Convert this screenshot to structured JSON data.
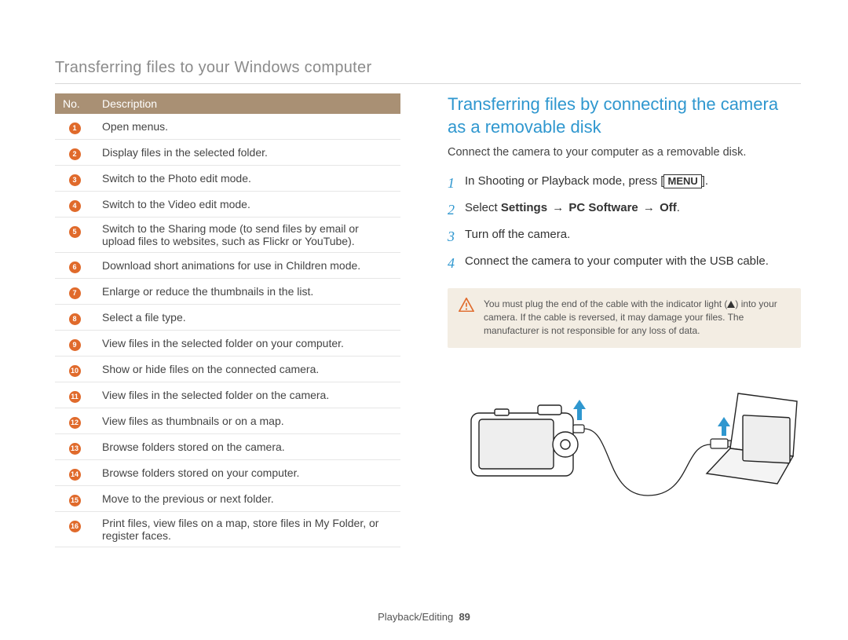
{
  "page_title": "Transferring files to your Windows computer",
  "table": {
    "headers": {
      "no": "No.",
      "desc": "Description"
    },
    "rows": [
      {
        "n": "1",
        "d": "Open menus."
      },
      {
        "n": "2",
        "d": "Display files in the selected folder."
      },
      {
        "n": "3",
        "d": "Switch to the Photo edit mode."
      },
      {
        "n": "4",
        "d": "Switch to the Video edit mode."
      },
      {
        "n": "5",
        "d": "Switch to the Sharing mode (to send files by email or upload files to websites, such as Flickr or YouTube)."
      },
      {
        "n": "6",
        "d": "Download short animations for use in Children mode."
      },
      {
        "n": "7",
        "d": "Enlarge or reduce the thumbnails in the list."
      },
      {
        "n": "8",
        "d": "Select a file type."
      },
      {
        "n": "9",
        "d": "View files in the selected folder on your computer."
      },
      {
        "n": "10",
        "d": "Show or hide files on the connected camera."
      },
      {
        "n": "11",
        "d": "View files in the selected folder on the camera."
      },
      {
        "n": "12",
        "d": "View files as thumbnails or on a map."
      },
      {
        "n": "13",
        "d": "Browse folders stored on the camera."
      },
      {
        "n": "14",
        "d": "Browse folders stored on your computer."
      },
      {
        "n": "15",
        "d": "Move to the previous or next folder."
      },
      {
        "n": "16",
        "d": "Print files, view files on a map, store files in My Folder, or register faces."
      }
    ]
  },
  "section": {
    "heading": "Transferring files by connecting the camera as a removable disk",
    "intro": "Connect the camera to your computer as a removable disk.",
    "steps": {
      "s1_a": "In Shooting or Playback mode, press [",
      "s1_menu": "MENU",
      "s1_b": "].",
      "s2_a": "Select ",
      "s2_bold_settings": "Settings",
      "s2_arrow": " → ",
      "s2_bold_pc": "PC Software",
      "s2_bold_off": "Off",
      "s2_end": ".",
      "s3": "Turn off the camera.",
      "s4": "Connect the camera to your computer with the USB cable."
    },
    "warning_a": "You must plug the end of the cable with the indicator light (",
    "warning_b": ") into your camera. If the cable is reversed, it may damage your files. The manufacturer is not responsible for any loss of data."
  },
  "footer": {
    "section": "Playback/Editing",
    "page": "89"
  }
}
